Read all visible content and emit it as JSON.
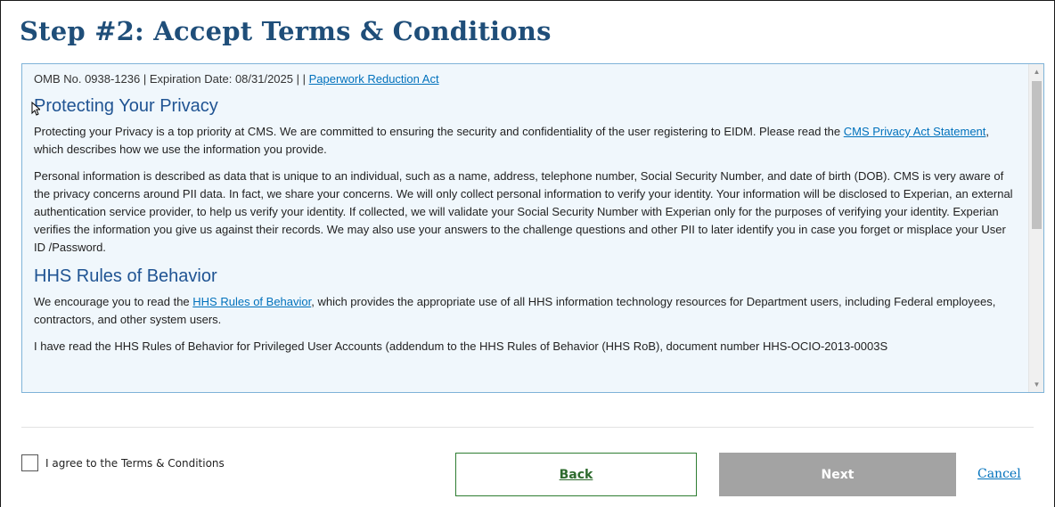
{
  "page": {
    "title": "Step #2: Accept Terms & Conditions"
  },
  "terms": {
    "omb_text": "OMB No. 0938-1236 | Expiration Date: 08/31/2025 | | ",
    "omb_link": "Paperwork Reduction Act",
    "privacy_heading": "Protecting Your Privacy",
    "privacy_p1_before": "Protecting your Privacy is a top priority at CMS. We are committed to ensuring the security and confidentiality of the user registering to EIDM. Please read the ",
    "privacy_p1_link": "CMS Privacy Act Statement",
    "privacy_p1_after": ", which describes how we use the information you provide.",
    "privacy_p2": "Personal information is described as data that is unique to an individual, such as a name, address, telephone number, Social Security Number, and date of birth (DOB). CMS is very aware of the privacy concerns around PII data. In fact, we share your concerns. We will only collect personal information to verify your identity. Your information will be disclosed to Experian, an external authentication service provider, to help us verify your identity. If collected, we will validate your Social Security Number with Experian only for the purposes of verifying your identity. Experian verifies the information you give us against their records. We may also use your answers to the challenge questions and other PII to later identify you in case you forget or misplace your User ID /Password.",
    "hhs_heading": "HHS Rules of Behavior",
    "hhs_p1_before": "We encourage you to read the ",
    "hhs_p1_link": "HHS Rules of Behavior",
    "hhs_p1_after": ", which provides the appropriate use of all HHS information technology resources for Department users, including Federal employees, contractors, and other system users.",
    "hhs_p2": "I have read the HHS Rules of Behavior for Privileged User Accounts (addendum to the HHS Rules of Behavior (HHS RoB), document number HHS-OCIO-2013-0003S"
  },
  "form": {
    "agree_label": "I agree to the Terms & Conditions",
    "agree_checked": false
  },
  "buttons": {
    "back": "Back",
    "next": "Next",
    "cancel": "Cancel"
  },
  "colors": {
    "title": "#1f4e79",
    "link": "#0071bc",
    "back_border": "#2e7d32",
    "next_disabled": "#a3a3a3",
    "terms_bg": "#f0f7fc"
  },
  "icons": {
    "scroll_up": "scroll-up-arrow-icon",
    "scroll_down": "scroll-down-arrow-icon",
    "cursor": "mouse-pointer-icon"
  }
}
